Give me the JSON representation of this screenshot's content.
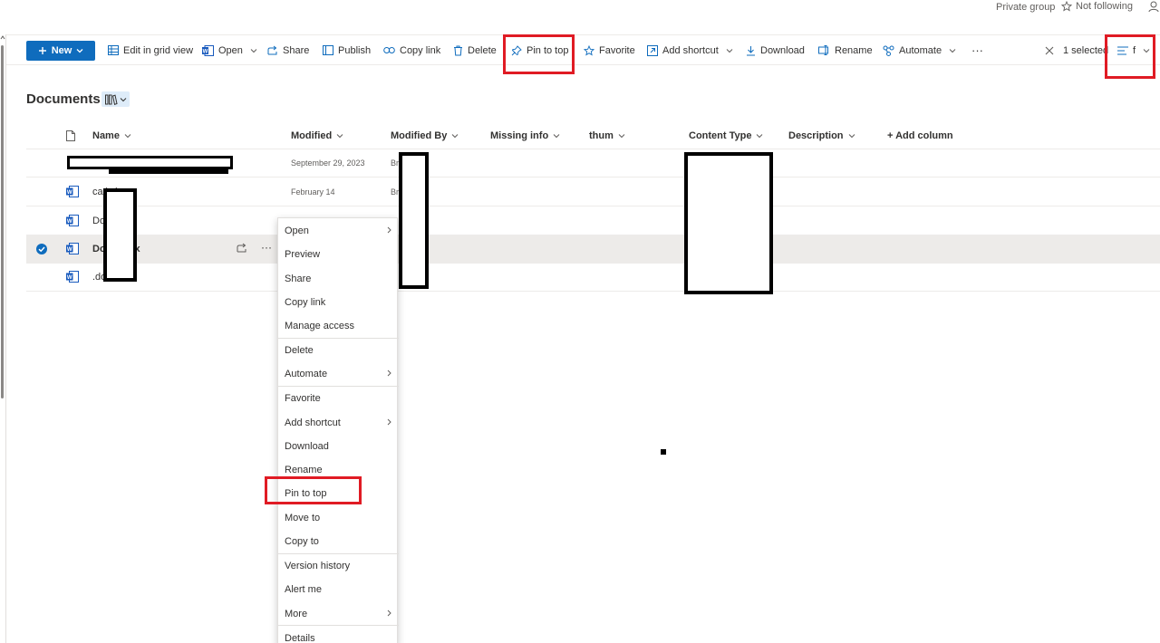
{
  "header": {
    "privacy": "Private group",
    "follow_label": "Not following"
  },
  "toolbar": {
    "new_label": "New",
    "items": [
      "Edit in grid view",
      "Open",
      "Share",
      "Publish",
      "Copy link",
      "Delete",
      "Pin to top",
      "Favorite",
      "Add shortcut",
      "Download",
      "Rename",
      "Automate"
    ],
    "more": "···",
    "selected_label": "1 selected",
    "view_label": "f"
  },
  "library": {
    "title": "Documents"
  },
  "columns": [
    "Name",
    "Modified",
    "Modified By",
    "Missing info",
    "thum",
    "Content Type",
    "Description",
    "+ Add column"
  ],
  "rows": [
    {
      "name": "",
      "modified": "September 29, 2023",
      "modified_by": "Br"
    },
    {
      "name": "ca        ).docx",
      "modified": "February 14",
      "modified_by": "Br"
    },
    {
      "name": "Do          .docx",
      "modified": "",
      "modified_by": ""
    },
    {
      "name": "Do          1.docx",
      "modified": "",
      "modified_by": ""
    },
    {
      "name": "            .docx",
      "modified": "",
      "modified_by": ""
    }
  ],
  "context_menu": {
    "items": [
      "Open",
      "Preview",
      "Share",
      "Copy link",
      "Manage access",
      "Delete",
      "Automate",
      "Favorite",
      "Add shortcut",
      "Download",
      "Rename",
      "Pin to top",
      "Move to",
      "Copy to",
      "Version history",
      "Alert me",
      "More",
      "Details"
    ]
  },
  "colors": {
    "accent": "#0f6cbd",
    "highlight": "#e01b24",
    "selected_row": "#edebe9",
    "word_blue": "#185abd"
  },
  "icons": [
    "person-icon",
    "star-icon",
    "plus-icon",
    "grid-view-icon",
    "word-icon",
    "share-icon",
    "publish-icon",
    "link-icon",
    "delete-icon",
    "pin-icon",
    "shortcut-icon",
    "download-icon",
    "rename-icon",
    "automate-icon",
    "close-icon",
    "view-options-icon",
    "library-view-icon",
    "file-icon",
    "check-circle-icon"
  ]
}
